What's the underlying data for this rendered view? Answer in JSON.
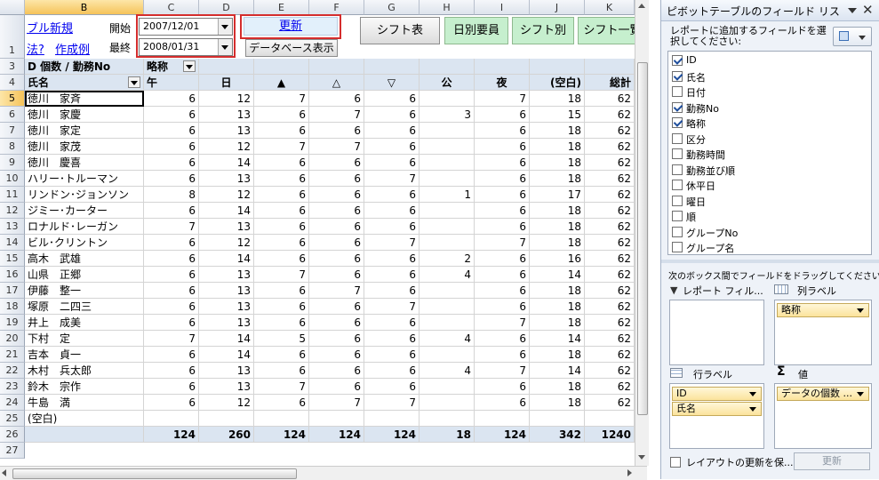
{
  "controls": {
    "link_new": "ブル新規",
    "link_help": "法?",
    "link_example": "作成例",
    "start_label": "開始",
    "start_value": "2007/12/01",
    "end_label": "最終",
    "end_value": "2008/01/31",
    "update_label": "更新",
    "db_show_label": "データベース表示",
    "shift_table_label": "シフト表",
    "daily_staff_label": "日別要員",
    "by_shift_label": "シフト別",
    "shift_list_label": "シフト一覧",
    "row1_number": "1"
  },
  "grid": {
    "columns": [
      "B",
      "C",
      "D",
      "E",
      "F",
      "G",
      "H",
      "I",
      "J",
      "K"
    ],
    "selected_column": "B",
    "pivot_title": "D 個数 / 勤務No",
    "col_field_label": "略称",
    "row_field_label": "氏名",
    "shift_headers": [
      "午",
      "日",
      "▲",
      "△",
      "▽",
      "公",
      "夜",
      "(空白)",
      "総計"
    ],
    "rows": [
      {
        "num": "5",
        "name": "徳川　家斉",
        "vals": [
          "6",
          "12",
          "7",
          "6",
          "6",
          "",
          "7",
          "18",
          "62"
        ]
      },
      {
        "num": "6",
        "name": "徳川　家慶",
        "vals": [
          "6",
          "13",
          "6",
          "7",
          "6",
          "3",
          "6",
          "15",
          "62"
        ]
      },
      {
        "num": "7",
        "name": "徳川　家定",
        "vals": [
          "6",
          "13",
          "6",
          "6",
          "6",
          "",
          "6",
          "18",
          "62"
        ]
      },
      {
        "num": "8",
        "name": "徳川　家茂",
        "vals": [
          "6",
          "12",
          "7",
          "7",
          "6",
          "",
          "6",
          "18",
          "62"
        ]
      },
      {
        "num": "9",
        "name": "徳川　慶喜",
        "vals": [
          "6",
          "14",
          "6",
          "6",
          "6",
          "",
          "6",
          "18",
          "62"
        ]
      },
      {
        "num": "10",
        "name": "ハリー･トルーマン",
        "vals": [
          "6",
          "13",
          "6",
          "6",
          "7",
          "",
          "6",
          "18",
          "62"
        ]
      },
      {
        "num": "11",
        "name": "リンドン･ジョンソン",
        "vals": [
          "8",
          "12",
          "6",
          "6",
          "6",
          "1",
          "6",
          "17",
          "62"
        ]
      },
      {
        "num": "12",
        "name": "ジミー･カーター",
        "vals": [
          "6",
          "14",
          "6",
          "6",
          "6",
          "",
          "6",
          "18",
          "62"
        ]
      },
      {
        "num": "13",
        "name": "ロナルド･レーガン",
        "vals": [
          "7",
          "13",
          "6",
          "6",
          "6",
          "",
          "6",
          "18",
          "62"
        ]
      },
      {
        "num": "14",
        "name": "ビル･クリントン",
        "vals": [
          "6",
          "12",
          "6",
          "6",
          "7",
          "",
          "7",
          "18",
          "62"
        ]
      },
      {
        "num": "15",
        "name": "高木　武雄",
        "vals": [
          "6",
          "14",
          "6",
          "6",
          "6",
          "2",
          "6",
          "16",
          "62"
        ]
      },
      {
        "num": "16",
        "name": "山県　正郷",
        "vals": [
          "6",
          "13",
          "7",
          "6",
          "6",
          "4",
          "6",
          "14",
          "62"
        ]
      },
      {
        "num": "17",
        "name": "伊藤　整一",
        "vals": [
          "6",
          "13",
          "6",
          "7",
          "6",
          "",
          "6",
          "18",
          "62"
        ]
      },
      {
        "num": "18",
        "name": "塚原　二四三",
        "vals": [
          "6",
          "13",
          "6",
          "6",
          "7",
          "",
          "6",
          "18",
          "62"
        ]
      },
      {
        "num": "19",
        "name": "井上　成美",
        "vals": [
          "6",
          "13",
          "6",
          "6",
          "6",
          "",
          "7",
          "18",
          "62"
        ]
      },
      {
        "num": "20",
        "name": "下村　定",
        "vals": [
          "7",
          "14",
          "5",
          "6",
          "6",
          "4",
          "6",
          "14",
          "62"
        ]
      },
      {
        "num": "21",
        "name": "吉本　貞一",
        "vals": [
          "6",
          "14",
          "6",
          "6",
          "6",
          "",
          "6",
          "18",
          "62"
        ]
      },
      {
        "num": "22",
        "name": "木村　兵太郎",
        "vals": [
          "6",
          "13",
          "6",
          "6",
          "6",
          "4",
          "7",
          "14",
          "62"
        ]
      },
      {
        "num": "23",
        "name": "鈴木　宗作",
        "vals": [
          "6",
          "13",
          "7",
          "6",
          "6",
          "",
          "6",
          "18",
          "62"
        ]
      },
      {
        "num": "24",
        "name": "牛島　満",
        "vals": [
          "6",
          "12",
          "6",
          "7",
          "7",
          "",
          "6",
          "18",
          "62"
        ]
      }
    ],
    "blank_row": {
      "num": "25",
      "name": "(空白)"
    },
    "total_row": {
      "num": "26",
      "vals": [
        "124",
        "260",
        "124",
        "124",
        "124",
        "18",
        "124",
        "342",
        "1240"
      ]
    },
    "row27_number": "27",
    "header_row_numbers": [
      "3",
      "4"
    ]
  },
  "panel": {
    "title": "ピボットテーブルのフィールド リス",
    "instruction": "レポートに追加するフィールドを選択してください:",
    "fields": [
      {
        "label": "ID",
        "checked": true
      },
      {
        "label": "氏名",
        "checked": true
      },
      {
        "label": "日付",
        "checked": false
      },
      {
        "label": "勤務No",
        "checked": true
      },
      {
        "label": "略称",
        "checked": true
      },
      {
        "label": "区分",
        "checked": false
      },
      {
        "label": "勤務時間",
        "checked": false
      },
      {
        "label": "勤務並び順",
        "checked": false
      },
      {
        "label": "休平日",
        "checked": false
      },
      {
        "label": "曜日",
        "checked": false
      },
      {
        "label": "順",
        "checked": false
      },
      {
        "label": "グループNo",
        "checked": false
      },
      {
        "label": "グループ名",
        "checked": false
      }
    ],
    "drag_instruction": "次のボックス間でフィールドをドラッグしてください:",
    "report_filter_label": "レポート フィル...",
    "column_label_title": "列ラベル",
    "column_chip": "略称",
    "row_label_title": "行ラベル",
    "values_title": "値",
    "row_chips": [
      "ID",
      "氏名"
    ],
    "value_chip": "データの個数 ...",
    "defer_label": "レイアウトの更新を保...",
    "update_button": "更新"
  }
}
